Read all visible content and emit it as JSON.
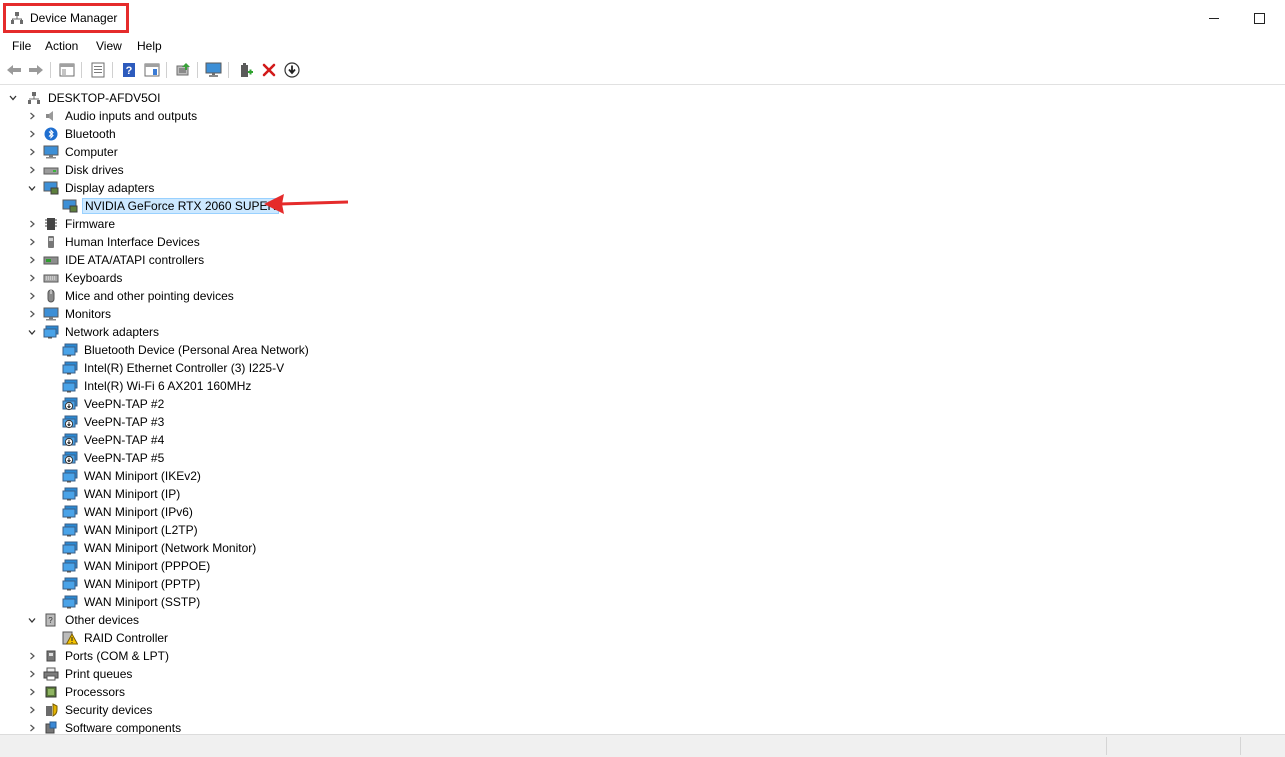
{
  "window": {
    "title": "Device Manager"
  },
  "menu": {
    "items": [
      "File",
      "Action",
      "View",
      "Help"
    ]
  },
  "tree": {
    "root": "DESKTOP-AFDV5OI",
    "categories": [
      {
        "label": "Audio inputs and outputs",
        "expanded": false,
        "icon": "speaker-icon"
      },
      {
        "label": "Bluetooth",
        "expanded": false,
        "icon": "bluetooth-icon"
      },
      {
        "label": "Computer",
        "expanded": false,
        "icon": "computer-icon"
      },
      {
        "label": "Disk drives",
        "expanded": false,
        "icon": "disk-drive-icon"
      },
      {
        "label": "Display adapters",
        "expanded": true,
        "icon": "display-adapter-icon",
        "children": [
          "NVIDIA GeForce RTX 2060 SUPER"
        ]
      },
      {
        "label": "Firmware",
        "expanded": false,
        "icon": "firmware-icon"
      },
      {
        "label": "Human Interface Devices",
        "expanded": false,
        "icon": "hid-icon"
      },
      {
        "label": "IDE ATA/ATAPI controllers",
        "expanded": false,
        "icon": "ide-controller-icon"
      },
      {
        "label": "Keyboards",
        "expanded": false,
        "icon": "keyboard-icon"
      },
      {
        "label": "Mice and other pointing devices",
        "expanded": false,
        "icon": "mouse-icon"
      },
      {
        "label": "Monitors",
        "expanded": false,
        "icon": "monitor-icon"
      },
      {
        "label": "Network adapters",
        "expanded": true,
        "icon": "network-adapter-icon",
        "children": [
          "Bluetooth Device (Personal Area Network)",
          "Intel(R) Ethernet Controller (3) I225-V",
          "Intel(R) Wi-Fi 6 AX201 160MHz",
          "VeePN-TAP #2",
          "VeePN-TAP #3",
          "VeePN-TAP #4",
          "VeePN-TAP #5",
          "WAN Miniport (IKEv2)",
          "WAN Miniport (IP)",
          "WAN Miniport (IPv6)",
          "WAN Miniport (L2TP)",
          "WAN Miniport (Network Monitor)",
          "WAN Miniport (PPPOE)",
          "WAN Miniport (PPTP)",
          "WAN Miniport (SSTP)"
        ]
      },
      {
        "label": "Other devices",
        "expanded": true,
        "icon": "other-devices-icon",
        "children": [
          "RAID Controller"
        ]
      },
      {
        "label": "Ports (COM & LPT)",
        "expanded": false,
        "icon": "port-icon"
      },
      {
        "label": "Print queues",
        "expanded": false,
        "icon": "printer-icon"
      },
      {
        "label": "Processors",
        "expanded": false,
        "icon": "processor-icon"
      },
      {
        "label": "Security devices",
        "expanded": false,
        "icon": "security-device-icon"
      },
      {
        "label": "Software components",
        "expanded": false,
        "icon": "software-component-icon"
      }
    ],
    "selected": "NVIDIA GeForce RTX 2060 SUPER"
  },
  "colors": {
    "highlight_red": "#e52b2b",
    "selection_bg": "#cce8ff",
    "selection_border": "#99d1ff",
    "network_blue": "#2a8ad4"
  }
}
